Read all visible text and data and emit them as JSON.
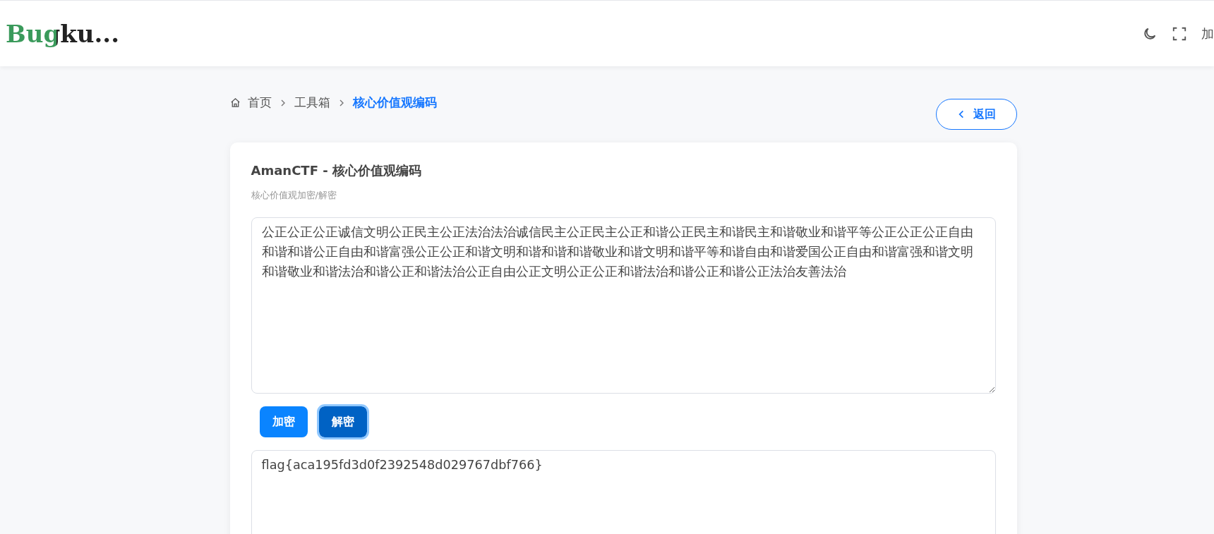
{
  "header": {
    "logo": "Bugku...",
    "right_text": "加"
  },
  "breadcrumb": [
    {
      "label": "首页",
      "current": false
    },
    {
      "label": "工具箱",
      "current": false
    },
    {
      "label": "核心价值观编码",
      "current": true
    }
  ],
  "back_button": "返回",
  "card": {
    "title": "AmanCTF - 核心价值观编码",
    "subtitle": "核心价值观加密/解密",
    "input": "公正公正公正诚信文明公正民主公正法治法治诚信民主公正民主公正和谐公正民主和谐民主和谐敬业和谐平等公正公正公正自由和谐和谐公正自由和谐富强公正公正和谐文明和谐和谐和谐敬业和谐文明和谐平等和谐自由和谐爱国公正自由和谐富强和谐文明和谐敬业和谐法治和谐公正和谐法治公正自由公正文明公正公正和谐法治和谐公正和谐公正法治友善法治",
    "buttons": [
      {
        "label": "加密",
        "focused": false
      },
      {
        "label": "解密",
        "focused": true
      }
    ],
    "output": "flag{aca195fd3d0f2392548d029767dbf766}"
  }
}
